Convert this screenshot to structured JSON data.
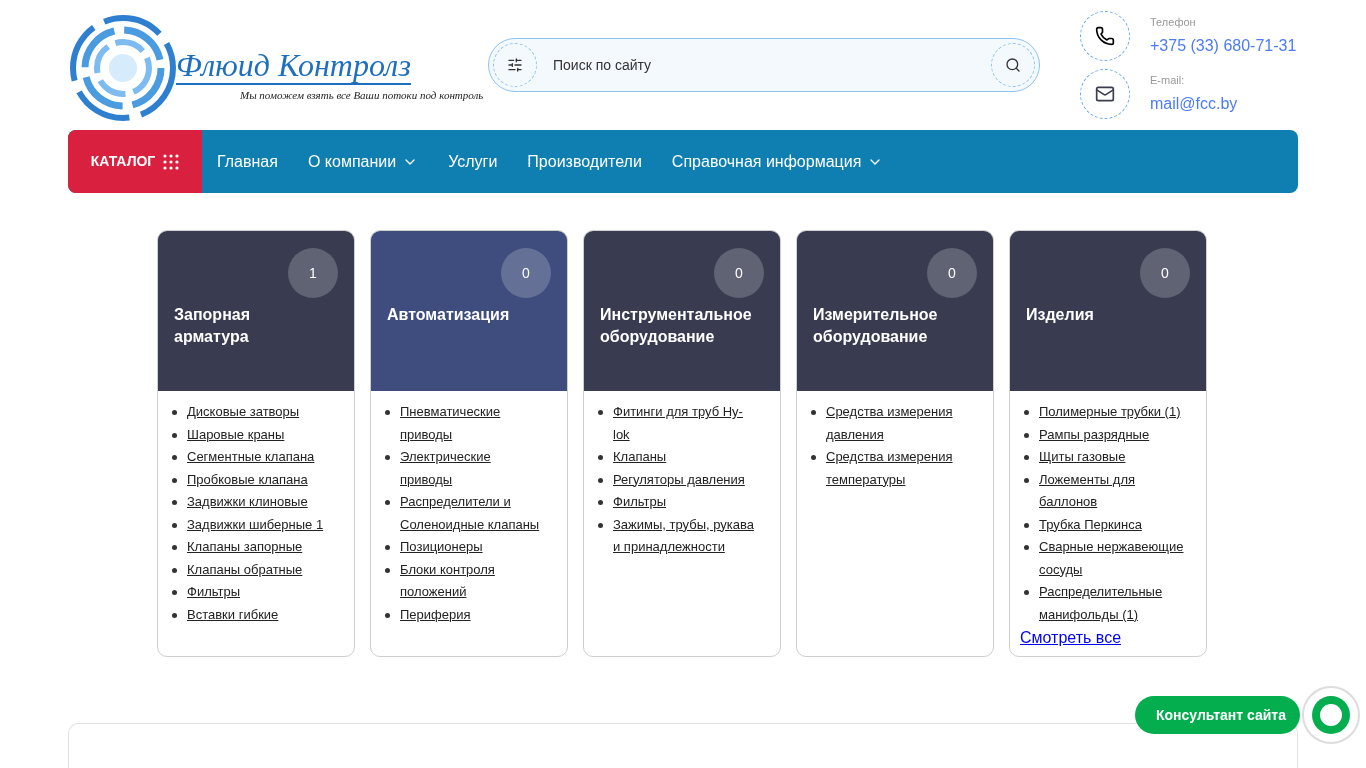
{
  "logo": {
    "title": "Флюид Контролз",
    "tagline": "Мы поможем взять все Ваши потоки под контроль"
  },
  "search": {
    "placeholder": "Поиск по сайту"
  },
  "contacts": [
    {
      "kind": "phone",
      "label": "Телефон",
      "value": "+375 (33) 680-71-31"
    },
    {
      "kind": "email",
      "label": "E-mail:",
      "value": "mail@fcc.by"
    }
  ],
  "nav": {
    "catalog": "КАТАЛОГ",
    "items": [
      {
        "label": "Главная",
        "has_dropdown": false
      },
      {
        "label": "О компании",
        "has_dropdown": true
      },
      {
        "label": "Услуги",
        "has_dropdown": false
      },
      {
        "label": "Производители",
        "has_dropdown": false
      },
      {
        "label": "Справочная информация",
        "has_dropdown": true
      }
    ]
  },
  "categories": [
    {
      "title": "Запорная арматура",
      "count": "1",
      "highlighted": false,
      "links": [
        "Дисковые затворы",
        "Шаровые краны",
        "Сегментные клапана",
        "Пробковые клапана",
        "Задвижки клиновые",
        "Задвижки шиберные 1",
        "Клапаны запорные",
        "Клапаны обратные",
        "Фильтры",
        "Вставки гибкие"
      ]
    },
    {
      "title": "Автоматизация",
      "count": "0",
      "highlighted": true,
      "links": [
        "Пневматические приводы",
        "Электрические приводы",
        "Распределители и Соленоидные клапаны",
        "Позиционеры",
        "Блоки контроля положений",
        "Периферия"
      ]
    },
    {
      "title": "Инструментальное оборудование",
      "count": "0",
      "highlighted": false,
      "links": [
        "Фитинги для труб Hy-lok",
        "Клапаны",
        "Регуляторы давления",
        "Фильтры",
        "Зажимы, трубы, рукава и принадлежности"
      ]
    },
    {
      "title": "Измерительное оборудование",
      "count": "0",
      "highlighted": false,
      "links": [
        "Средства измерения давления",
        "Средства измерения температуры"
      ]
    },
    {
      "title": "Изделия",
      "count": "0",
      "highlighted": false,
      "links": [
        "Полимерные трубки (1)",
        "Рампы разрядные",
        "Щиты газовые",
        "Ложементы для баллонов",
        "Трубка Перкинса",
        "Сварные нержавеющие сосуды",
        "Распределительные манифольды (1)"
      ],
      "more": "Смотреть все"
    }
  ],
  "consultant": {
    "label": "Консультант сайта"
  }
}
